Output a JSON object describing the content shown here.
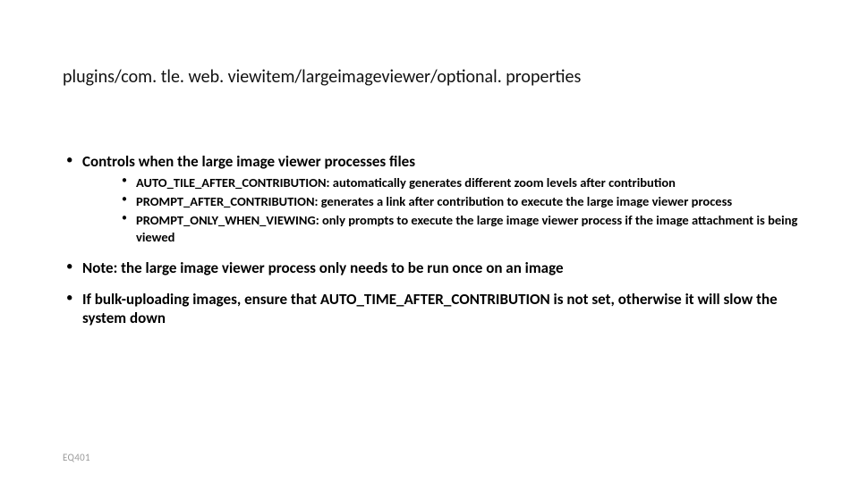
{
  "title": "plugins/com. tle. web. viewitem/largeimageviewer/optional. properties",
  "bullets": {
    "controls": {
      "text": "Controls when the large image viewer processes files",
      "sub": [
        "AUTO_TILE_AFTER_CONTRIBUTION:  automatically generates different zoom levels after contribution",
        "PROMPT_AFTER_CONTRIBUTION: generates a link after contribution to execute the large image viewer process",
        "PROMPT_ONLY_WHEN_VIEWING:  only prompts to execute the large image viewer process if the image attachment is being viewed"
      ]
    },
    "note": "Note:  the large image viewer process only needs to be run once on an image",
    "bulk": "If bulk-uploading images, ensure that AUTO_TIME_AFTER_CONTRIBUTION is not set, otherwise it will slow the system down"
  },
  "footer": "EQ401"
}
